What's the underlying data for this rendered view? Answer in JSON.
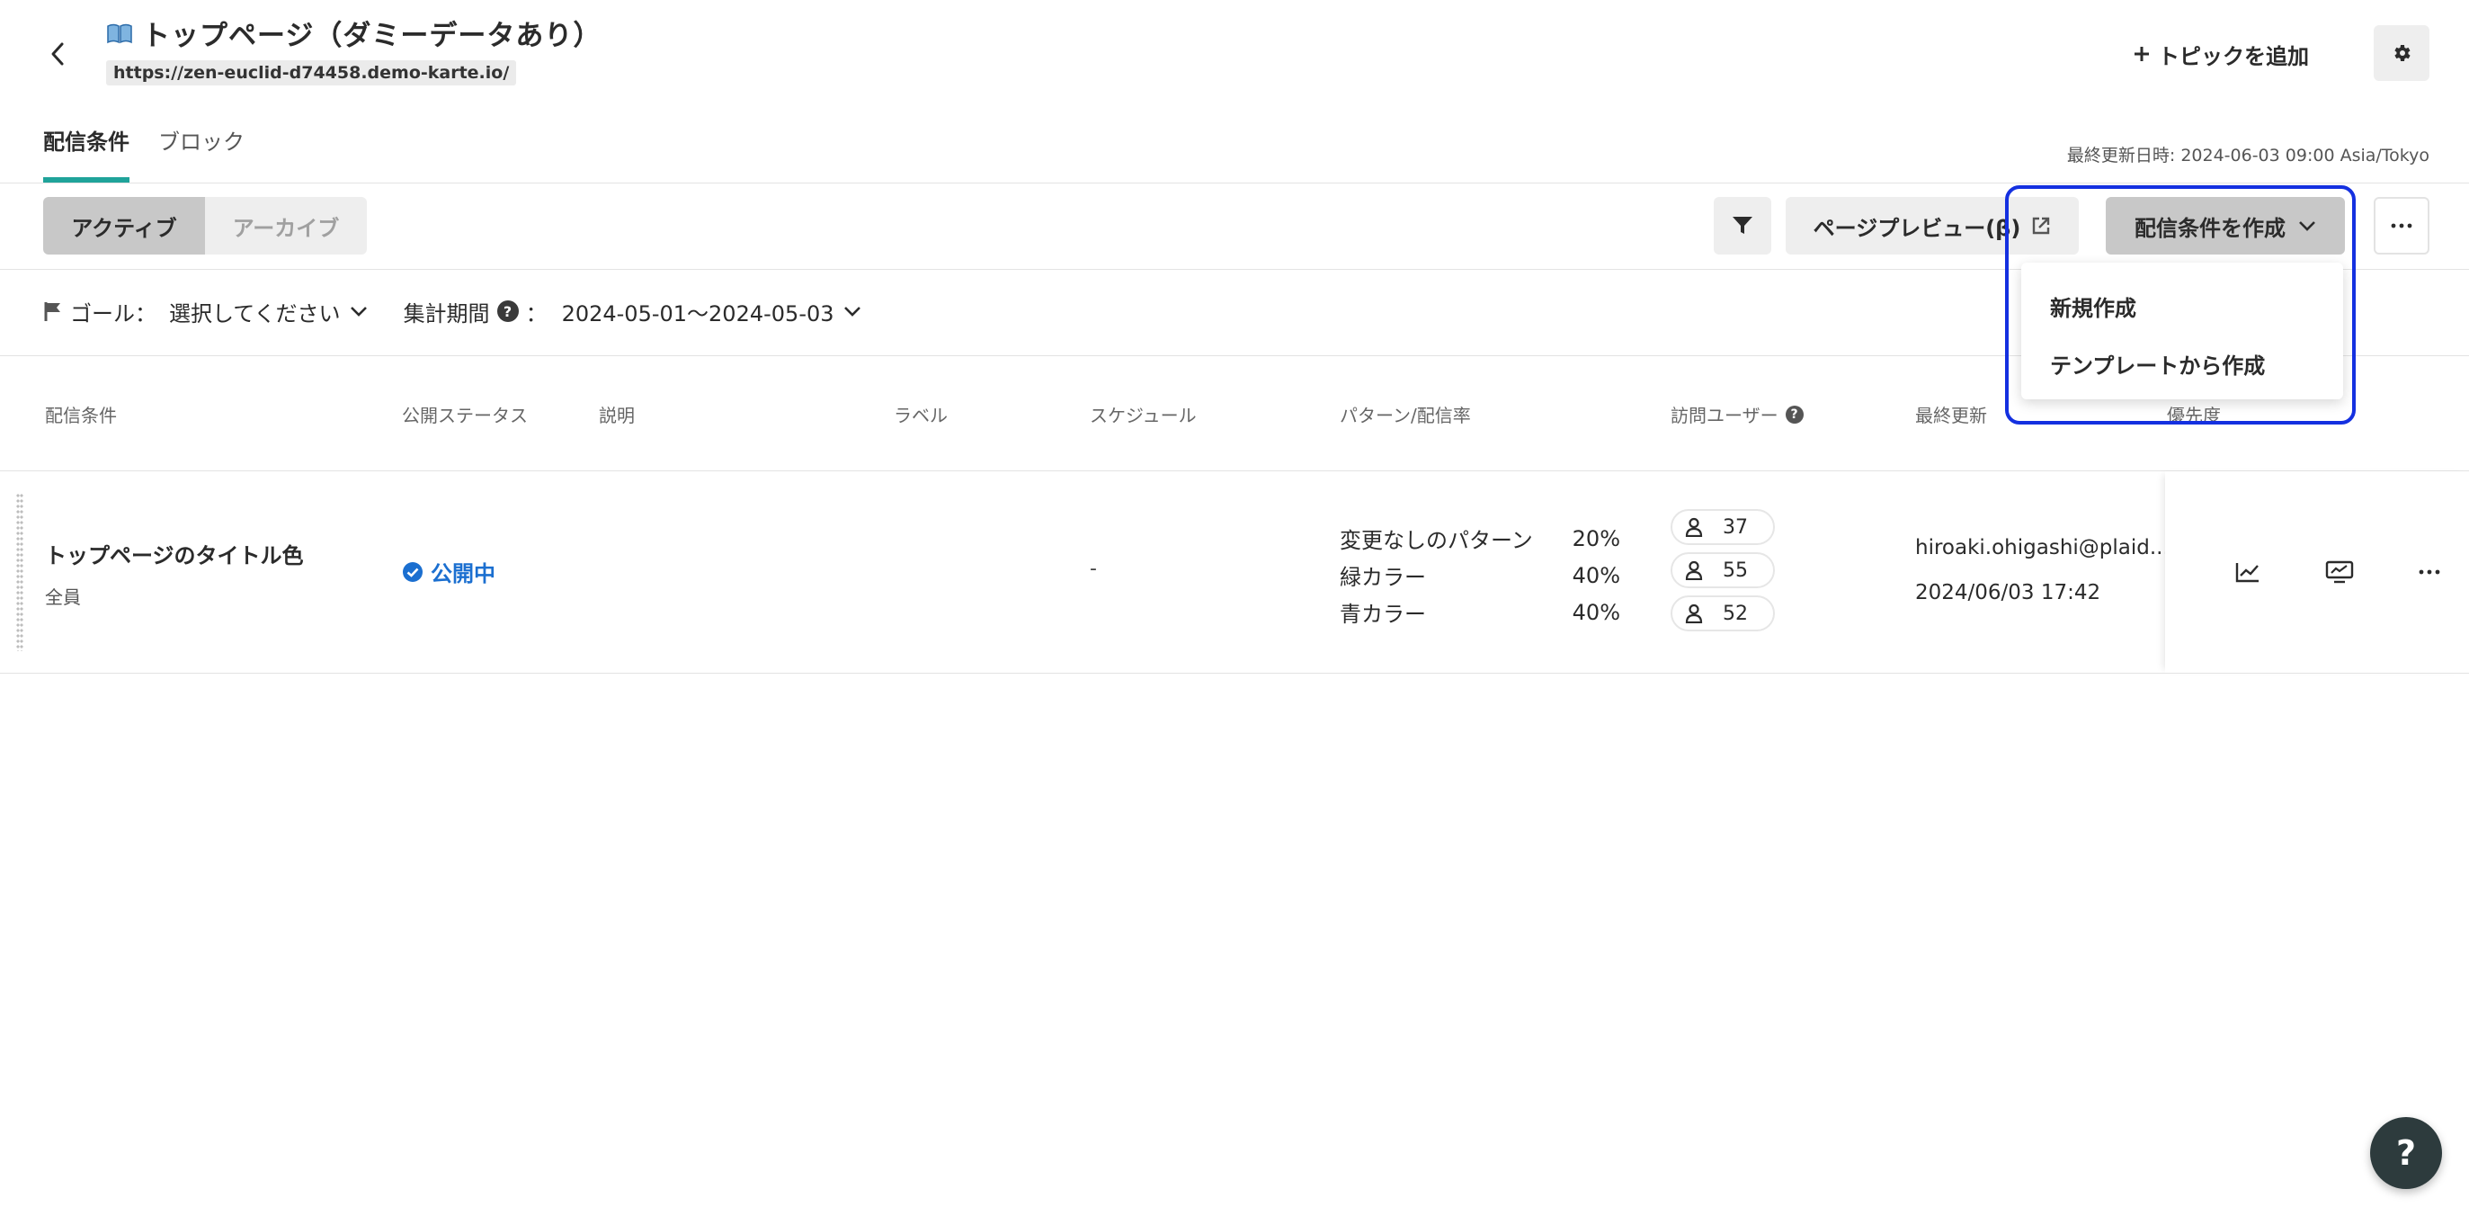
{
  "header": {
    "title": "トップページ（ダミーデータあり）",
    "url": "https://zen-euclid-d74458.demo-karte.io/",
    "add_topic_label": "トピックを追加"
  },
  "tabs": [
    {
      "label": "配信条件",
      "active": true
    },
    {
      "label": "ブロック",
      "active": false
    }
  ],
  "last_updated": "最終更新日時: 2024-06-03 09:00 Asia/Tokyo",
  "toolbar": {
    "segments": [
      {
        "label": "アクティブ",
        "active": true
      },
      {
        "label": "アーカイブ",
        "active": false
      }
    ],
    "preview_label": "ページプレビュー(β)",
    "create_label": "配信条件を作成"
  },
  "create_menu": {
    "items": [
      "新規作成",
      "テンプレートから作成"
    ]
  },
  "filters": {
    "goal_label": "ゴール：",
    "goal_value": "選択してください",
    "period_label": "集計期間",
    "period_sep": "：",
    "period_value": "2024-05-01〜2024-05-03"
  },
  "table": {
    "columns": [
      "配信条件",
      "公開ステータス",
      "説明",
      "ラベル",
      "スケジュール",
      "パターン/配信率",
      "訪問ユーザー",
      "最終更新",
      "優先度"
    ],
    "rows": [
      {
        "name": "トップページのタイトル色",
        "target": "全員",
        "status": "公開中",
        "schedule": "-",
        "patterns": [
          {
            "name": "変更なしのパターン",
            "rate": "20%",
            "visitors": "37"
          },
          {
            "name": "緑カラー",
            "rate": "40%",
            "visitors": "55"
          },
          {
            "name": "青カラー",
            "rate": "40%",
            "visitors": "52"
          }
        ],
        "updated_by": "hiroaki.ohigashi@plaid....",
        "updated_at": "2024/06/03 17:42"
      }
    ]
  },
  "help_label": "?",
  "colors": {
    "accent": "#1fa39a",
    "status_blue": "#1b6fd0",
    "highlight": "#1430e0"
  }
}
